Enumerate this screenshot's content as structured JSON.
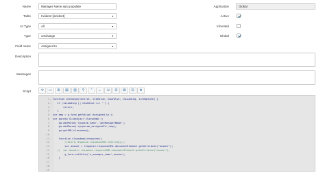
{
  "form": {
    "name": {
      "label": "Name",
      "value": "Manager Name auto populate"
    },
    "table": {
      "label": "Table",
      "value": "Incident [incident]"
    },
    "ui_type": {
      "label": "UI Type",
      "value": "All"
    },
    "type": {
      "label": "Type",
      "value": "onChange"
    },
    "field_name": {
      "label": "Field name",
      "value": "Assigned to"
    },
    "description": {
      "label": "Description",
      "value": ""
    },
    "messages": {
      "label": "Messages",
      "value": ""
    },
    "script": {
      "label": "Script"
    }
  },
  "right": {
    "application": {
      "label": "Application",
      "value": "Global"
    },
    "active": {
      "label": "Active",
      "checked": true
    },
    "inherited": {
      "label": "Inherited",
      "checked": false
    },
    "global": {
      "label": "Global",
      "checked": true
    }
  },
  "toolbar": {
    "icons": [
      "toggle-comment-icon",
      "comment-icon",
      "format-code-icon",
      "check-syntax-icon",
      "replace-icon",
      "search-icon",
      "collapse-icon",
      "expand-icon",
      "go-to-line-icon",
      "script-debugger-icon",
      "save-icon",
      "full-screen-icon",
      "help-icon"
    ],
    "glyphs": [
      "⟲",
      "▭",
      "⊞",
      "▤",
      "▥",
      "⚲",
      "⌃",
      "⌄",
      "⇲",
      "⊟",
      "⊠",
      "⊡",
      "⊕"
    ]
  },
  "code": {
    "lines": [
      {
        "n": "1",
        "fold": "⌄",
        "text": "function onChange(control, oldValue, newValue, isLoading, isTemplate) {"
      },
      {
        "n": "2",
        "fold": "⌄",
        "text": "   if (isLoading || newValue === '') {"
      },
      {
        "n": "3",
        "fold": "",
        "text": "       return;"
      },
      {
        "n": "4",
        "fold": "",
        "text": "   }"
      },
      {
        "n": "5",
        "fold": "",
        "text": "var emp = g_form.getValue('assigned_to');"
      },
      {
        "n": "6",
        "fold": "",
        "text": "var ga=new GlideAjax('classdemo');"
      },
      {
        "n": "7",
        "fold": "",
        "text": "    ga.addParam('sysparm_name','getManagerName');"
      },
      {
        "n": "8",
        "fold": "",
        "text": "    ga.addParam('sysparam_assignedTo',emp);"
      },
      {
        "n": "9",
        "fold": "",
        "text": "    ga.getXML(classdemo);"
      },
      {
        "n": "10",
        "fold": "",
        "text": ""
      },
      {
        "n": "11",
        "fold": "⌄",
        "text": "    function classdemo(response){"
      },
      {
        "n": "12",
        "fold": "",
        "text": "        //alert(response.responseXML.toString());",
        "comment": true
      },
      {
        "n": "13",
        "fold": "",
        "text": "        var answer = response.responseXML.documentElement.getAttribute(\"answer\");"
      },
      {
        "n": "14",
        "fold": "",
        "text": "   //  var answer= response.responseXML.documentElement.getAttribute(\"answer\");",
        "comment": true
      },
      {
        "n": "15",
        "fold": "",
        "text": "        g_form.setValue('u_manager_name',answer);"
      },
      {
        "n": "16",
        "fold": "",
        "text": "    }"
      },
      {
        "n": "17",
        "fold": "",
        "text": ""
      },
      {
        "n": "18",
        "fold": "",
        "text": ""
      },
      {
        "n": "19",
        "fold": "",
        "text": ""
      }
    ]
  }
}
